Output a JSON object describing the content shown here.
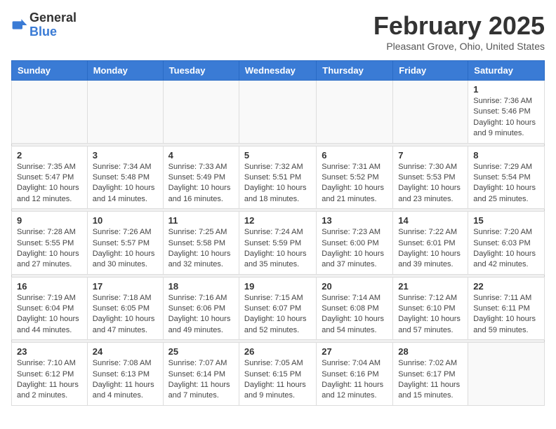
{
  "logo": {
    "general": "General",
    "blue": "Blue"
  },
  "title": {
    "month": "February 2025",
    "location": "Pleasant Grove, Ohio, United States"
  },
  "days_of_week": [
    "Sunday",
    "Monday",
    "Tuesday",
    "Wednesday",
    "Thursday",
    "Friday",
    "Saturday"
  ],
  "weeks": [
    {
      "days": [
        {
          "num": "",
          "info": ""
        },
        {
          "num": "",
          "info": ""
        },
        {
          "num": "",
          "info": ""
        },
        {
          "num": "",
          "info": ""
        },
        {
          "num": "",
          "info": ""
        },
        {
          "num": "",
          "info": ""
        },
        {
          "num": "1",
          "info": "Sunrise: 7:36 AM\nSunset: 5:46 PM\nDaylight: 10 hours\nand 9 minutes."
        }
      ]
    },
    {
      "days": [
        {
          "num": "2",
          "info": "Sunrise: 7:35 AM\nSunset: 5:47 PM\nDaylight: 10 hours\nand 12 minutes."
        },
        {
          "num": "3",
          "info": "Sunrise: 7:34 AM\nSunset: 5:48 PM\nDaylight: 10 hours\nand 14 minutes."
        },
        {
          "num": "4",
          "info": "Sunrise: 7:33 AM\nSunset: 5:49 PM\nDaylight: 10 hours\nand 16 minutes."
        },
        {
          "num": "5",
          "info": "Sunrise: 7:32 AM\nSunset: 5:51 PM\nDaylight: 10 hours\nand 18 minutes."
        },
        {
          "num": "6",
          "info": "Sunrise: 7:31 AM\nSunset: 5:52 PM\nDaylight: 10 hours\nand 21 minutes."
        },
        {
          "num": "7",
          "info": "Sunrise: 7:30 AM\nSunset: 5:53 PM\nDaylight: 10 hours\nand 23 minutes."
        },
        {
          "num": "8",
          "info": "Sunrise: 7:29 AM\nSunset: 5:54 PM\nDaylight: 10 hours\nand 25 minutes."
        }
      ]
    },
    {
      "days": [
        {
          "num": "9",
          "info": "Sunrise: 7:28 AM\nSunset: 5:55 PM\nDaylight: 10 hours\nand 27 minutes."
        },
        {
          "num": "10",
          "info": "Sunrise: 7:26 AM\nSunset: 5:57 PM\nDaylight: 10 hours\nand 30 minutes."
        },
        {
          "num": "11",
          "info": "Sunrise: 7:25 AM\nSunset: 5:58 PM\nDaylight: 10 hours\nand 32 minutes."
        },
        {
          "num": "12",
          "info": "Sunrise: 7:24 AM\nSunset: 5:59 PM\nDaylight: 10 hours\nand 35 minutes."
        },
        {
          "num": "13",
          "info": "Sunrise: 7:23 AM\nSunset: 6:00 PM\nDaylight: 10 hours\nand 37 minutes."
        },
        {
          "num": "14",
          "info": "Sunrise: 7:22 AM\nSunset: 6:01 PM\nDaylight: 10 hours\nand 39 minutes."
        },
        {
          "num": "15",
          "info": "Sunrise: 7:20 AM\nSunset: 6:03 PM\nDaylight: 10 hours\nand 42 minutes."
        }
      ]
    },
    {
      "days": [
        {
          "num": "16",
          "info": "Sunrise: 7:19 AM\nSunset: 6:04 PM\nDaylight: 10 hours\nand 44 minutes."
        },
        {
          "num": "17",
          "info": "Sunrise: 7:18 AM\nSunset: 6:05 PM\nDaylight: 10 hours\nand 47 minutes."
        },
        {
          "num": "18",
          "info": "Sunrise: 7:16 AM\nSunset: 6:06 PM\nDaylight: 10 hours\nand 49 minutes."
        },
        {
          "num": "19",
          "info": "Sunrise: 7:15 AM\nSunset: 6:07 PM\nDaylight: 10 hours\nand 52 minutes."
        },
        {
          "num": "20",
          "info": "Sunrise: 7:14 AM\nSunset: 6:08 PM\nDaylight: 10 hours\nand 54 minutes."
        },
        {
          "num": "21",
          "info": "Sunrise: 7:12 AM\nSunset: 6:10 PM\nDaylight: 10 hours\nand 57 minutes."
        },
        {
          "num": "22",
          "info": "Sunrise: 7:11 AM\nSunset: 6:11 PM\nDaylight: 10 hours\nand 59 minutes."
        }
      ]
    },
    {
      "days": [
        {
          "num": "23",
          "info": "Sunrise: 7:10 AM\nSunset: 6:12 PM\nDaylight: 11 hours\nand 2 minutes."
        },
        {
          "num": "24",
          "info": "Sunrise: 7:08 AM\nSunset: 6:13 PM\nDaylight: 11 hours\nand 4 minutes."
        },
        {
          "num": "25",
          "info": "Sunrise: 7:07 AM\nSunset: 6:14 PM\nDaylight: 11 hours\nand 7 minutes."
        },
        {
          "num": "26",
          "info": "Sunrise: 7:05 AM\nSunset: 6:15 PM\nDaylight: 11 hours\nand 9 minutes."
        },
        {
          "num": "27",
          "info": "Sunrise: 7:04 AM\nSunset: 6:16 PM\nDaylight: 11 hours\nand 12 minutes."
        },
        {
          "num": "28",
          "info": "Sunrise: 7:02 AM\nSunset: 6:17 PM\nDaylight: 11 hours\nand 15 minutes."
        },
        {
          "num": "",
          "info": ""
        }
      ]
    }
  ]
}
